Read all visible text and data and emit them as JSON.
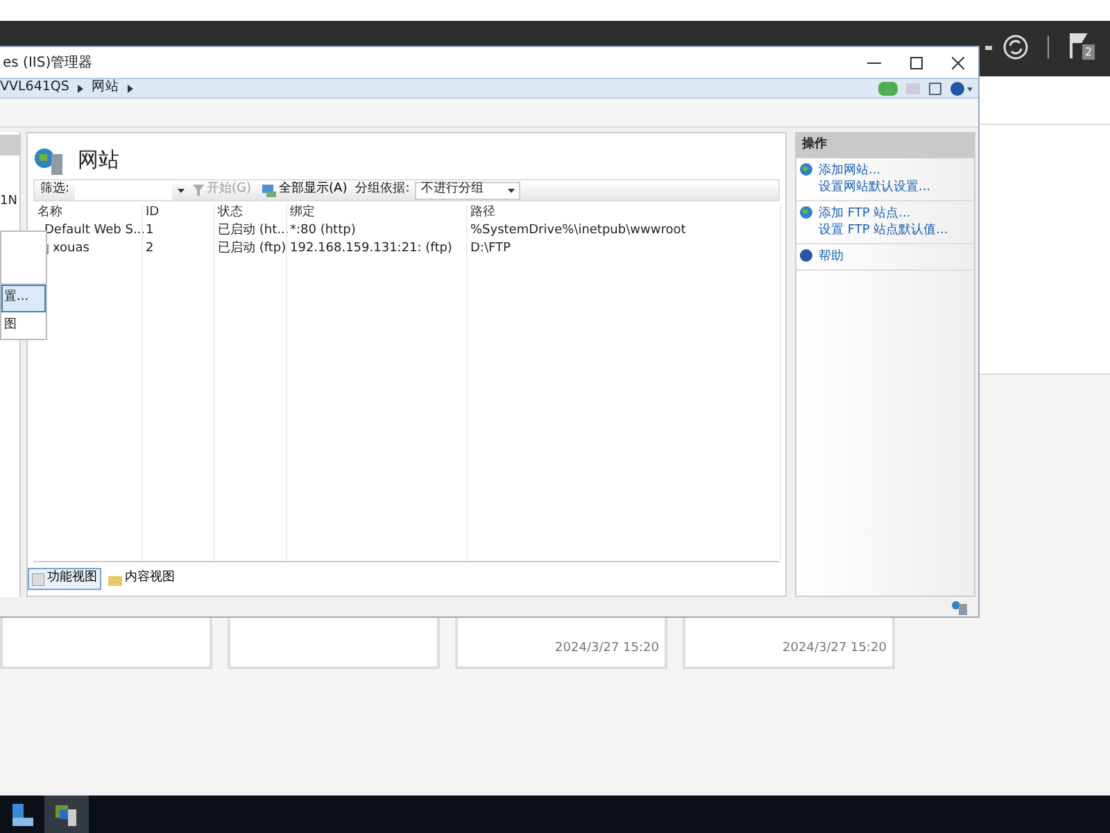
{
  "server_manager": {
    "notification_count": "2",
    "tiles": [
      {
        "kind": "blank"
      },
      {
        "kind": "blank"
      },
      {
        "kind": "dated",
        "timestamp": "2024/3/27 15:20"
      },
      {
        "kind": "dated",
        "timestamp": "2024/3/27 15:20"
      }
    ]
  },
  "iis_window": {
    "title": "es (IIS)管理器",
    "address": [
      "VVL641QS",
      "网站"
    ],
    "left_panel_text": "1N",
    "context_menu": [
      {
        "label": "置...",
        "selected": true
      },
      {
        "label": "图",
        "selected": false
      }
    ],
    "page_title": "网站",
    "filter": {
      "label": "筛选:",
      "start": "开始(G)",
      "start_disabled": true,
      "show_all": "全部显示(A)",
      "group_label": "分组依据:",
      "group_value": "不进行分组"
    },
    "table": {
      "columns": [
        "名称",
        "ID",
        "状态",
        "绑定",
        "路径"
      ],
      "rows": [
        {
          "cells": [
            "Default Web S...",
            "1",
            "已启动 (ht...",
            "*:80 (http)",
            "%SystemDrive%\\inetpub\\wwwroot"
          ]
        },
        {
          "cells": [
            "xouas",
            "2",
            "已启动 (ftp)",
            "192.168.159.131:21: (ftp)",
            "D:\\FTP"
          ]
        }
      ]
    },
    "view_tabs": [
      {
        "label": "功能视图",
        "selected": true
      },
      {
        "label": "内容视图",
        "selected": false
      }
    ],
    "actions": {
      "title": "操作",
      "groups": [
        {
          "links": [
            "添加网站...",
            "设置网站默认设置..."
          ]
        },
        {
          "links": [
            "添加 FTP 站点...",
            "设置 FTP 站点默认值..."
          ]
        },
        {
          "links": [
            "帮助"
          ]
        }
      ]
    }
  }
}
